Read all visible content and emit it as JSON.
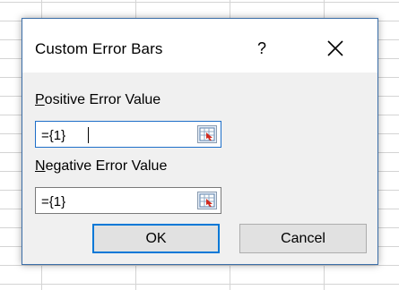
{
  "dialog": {
    "title": "Custom Error Bars",
    "help_label": "?",
    "positive": {
      "label_key": "P",
      "label_rest": "ositive Error Value",
      "value": "={1}"
    },
    "negative": {
      "label_key": "N",
      "label_rest": "egative Error Value",
      "value": "={1}"
    },
    "ok_label": "OK",
    "cancel_label": "Cancel"
  },
  "icons": {
    "close": "close-icon",
    "collapse": "range-collapse-icon"
  },
  "colors": {
    "focus_border": "#1e6fc8",
    "default_button_border": "#0078d7",
    "dialog_border": "#3b6ea8"
  }
}
